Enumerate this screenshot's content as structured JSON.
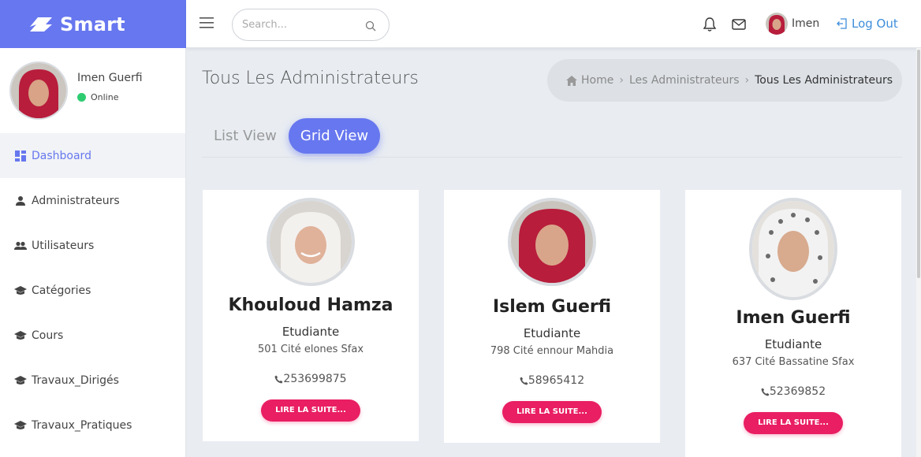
{
  "brand": {
    "name": "Smart"
  },
  "user": {
    "name": "Imen Guerfi",
    "status": "Online"
  },
  "sidebar": {
    "items": [
      {
        "label": "Dashboard",
        "icon": "dashboard-icon"
      },
      {
        "label": "Administrateurs",
        "icon": "person-icon"
      },
      {
        "label": "Utilisateurs",
        "icon": "people-icon"
      },
      {
        "label": "Catégories",
        "icon": "graduation-cap-icon"
      },
      {
        "label": "Cours",
        "icon": "graduation-cap-icon"
      },
      {
        "label": "Travaux_Dirigés",
        "icon": "graduation-cap-icon"
      },
      {
        "label": "Travaux_Pratiques",
        "icon": "graduation-cap-icon"
      }
    ]
  },
  "header": {
    "search_placeholder": "Search...",
    "user_name": "Imen",
    "logout_label": "Log Out"
  },
  "page": {
    "title": "Tous Les Administrateurs",
    "breadcrumb": [
      "Home",
      "Les Administrateurs",
      "Tous Les Administrateurs"
    ]
  },
  "tabs": [
    "List View",
    "Grid View"
  ],
  "cards": [
    {
      "name": "Khouloud Hamza",
      "role": "Etudiante",
      "address": "501 Cité elones Sfax",
      "phone": "253699875",
      "button": "LIRE LA SUITE..."
    },
    {
      "name": "Islem Guerfi",
      "role": "Etudiante",
      "address": "798 Cité ennour Mahdia",
      "phone": "58965412",
      "button": "LIRE LA SUITE..."
    },
    {
      "name": "Imen Guerfi",
      "role": "Etudiante",
      "address": "637 Cité Bassatine Sfax",
      "phone": "52369852",
      "button": "LIRE LA SUITE..."
    }
  ],
  "colors": {
    "accent": "#6777ef",
    "button": "#e91e63",
    "link": "#3d8eda",
    "online": "#2ecc71"
  }
}
